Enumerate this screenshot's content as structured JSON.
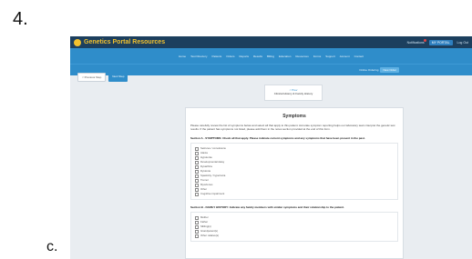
{
  "outer": {
    "step_number": "4.",
    "sub_letter": "c."
  },
  "app": {
    "brand": "Genetics Portal Resources",
    "top_links": [
      {
        "label": "Notifications",
        "active": false
      },
      {
        "label": "MY PORTAL",
        "active": true
      },
      {
        "label": "Log Out",
        "active": false
      }
    ]
  },
  "nav": {
    "items": [
      "Home",
      "Test Directory",
      "Patients",
      "Orders",
      "Reports",
      "Results",
      "Billing",
      "Education",
      "Resources",
      "Forms",
      "Support",
      "Account",
      "Contact"
    ]
  },
  "subbar": {
    "text": "Online Ordering",
    "button": "New Order"
  },
  "buttons": {
    "back": "< Previous Step",
    "next": "Next Step"
  },
  "pager": {
    "prev": "< Prev",
    "title": "Clinical History & Family History"
  },
  "content": {
    "title": "Symptoms",
    "intro": "Please carefully review the list of symptoms below and select all that apply to this patient. Accurate symptom reporting helps our laboratory team interpret the genetic test results. If the patient has symptoms not listed, please add them in the notes section provided at the end of this form.",
    "section1": "Section A - SYMPTOMS: Check all that apply. Please indicate current symptoms and any symptoms that have been present in the past.",
    "section1_items": [
      "Seizures / convulsions",
      "Ataxia",
      "Hypotonia",
      "Developmental delay",
      "Dysarthria",
      "Dystonia",
      "Spasticity / hypertonia",
      "Tremor",
      "Myoclonus",
      "Other",
      "Cognitive impairment"
    ],
    "section2": "Section B - FAMILY HISTORY: Indicate any family members with similar symptoms and their relationship to the patient.",
    "section2_items": [
      "Mother",
      "Father",
      "Sibling(s)",
      "Grandparent(s)",
      "Other relative(s)"
    ]
  }
}
